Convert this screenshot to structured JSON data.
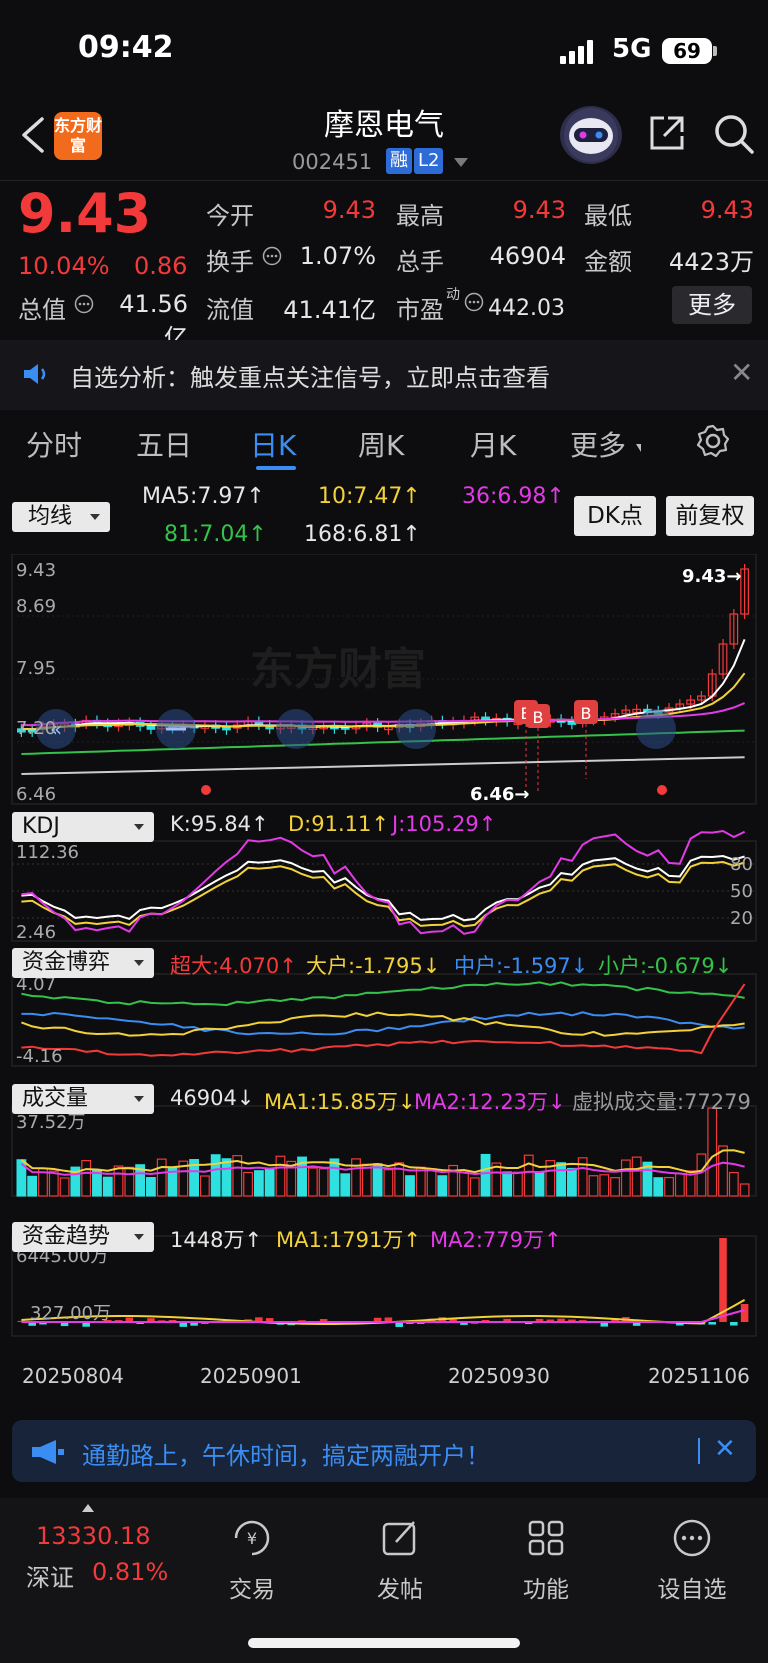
{
  "status": {
    "time": "09:42",
    "network": "5G",
    "battery": "69"
  },
  "header": {
    "logo_text": "东方财富",
    "name": "摩恩电气",
    "code": "002451",
    "tag_rong": "融",
    "tag_l2": "L2"
  },
  "quote": {
    "price": "9.43",
    "pct": "10.04%",
    "change": "0.86",
    "labels": {
      "open": "今开",
      "high": "最高",
      "low": "最低",
      "turnover": "换手",
      "volume": "总手",
      "amount": "金额",
      "total_cap": "总值",
      "float_cap": "流值",
      "pe": "市盈",
      "pe_sup": "动"
    },
    "values": {
      "open": "9.43",
      "high": "9.43",
      "low": "9.43",
      "turnover": "1.07%",
      "volume": "46904",
      "amount": "4423万",
      "total_cap": "41.56亿",
      "float_cap": "41.41亿",
      "pe": "442.03"
    },
    "more_label": "更多"
  },
  "notice": {
    "text": "自选分析：触发重点关注信号，立即点击查看"
  },
  "tabs": [
    "分时",
    "五日",
    "日K",
    "周K",
    "月K",
    "更多"
  ],
  "ma_bar": {
    "selector": "均线",
    "ma5": "MA5:7.97↑",
    "ma10": "10:7.47↑",
    "ma36": "36:6.98↑",
    "ma81": "81:7.04↑",
    "ma168": "168:6.81↑",
    "dk_button": "DK点",
    "adjust_button": "前复权"
  },
  "kline": {
    "y_labels": [
      "9.43",
      "8.69",
      "7.95",
      "7.20",
      "6.46"
    ],
    "high_tag": "9.43→",
    "low_tag": "6.46→",
    "watermark": "东方财富",
    "signals": [
      "B",
      "B",
      "B"
    ]
  },
  "kdj": {
    "selector": "KDJ",
    "k": "K:95.84↑",
    "d": "D:91.11↑",
    "j": "J:105.29↑",
    "y_top": "112.36",
    "y_bottom": "2.46",
    "levels": [
      "80",
      "50",
      "20"
    ]
  },
  "capital_game": {
    "selector": "资金博弈",
    "super": "超大:4.070↑",
    "big": "大户:-1.795↓",
    "mid": "中户:-1.597↓",
    "small": "小户:-0.679↓",
    "y_top": "4.07",
    "y_bottom": "-4.16"
  },
  "volume": {
    "selector": "成交量",
    "value": "46904↓",
    "ma1": "MA1:15.85万↓",
    "ma2": "MA2:12.23万↓",
    "virtual": "虚拟成交量:77279",
    "y_top": "37.52万"
  },
  "capital_trend": {
    "selector": "资金趋势",
    "value": "1448万↑",
    "ma1": "MA1:1791万↑",
    "ma2": "MA2:779万↑",
    "y_top": "6445.00万",
    "y_mid": "327.00万"
  },
  "dates": [
    "20250804",
    "20250901",
    "20250930",
    "20251106"
  ],
  "banner": {
    "text": "通勤路上，午休时间，搞定两融开户！"
  },
  "bottom_nav": {
    "index_value": "13330.18",
    "index_name": "深证",
    "index_pct": "0.81%",
    "items": [
      "交易",
      "发帖",
      "功能",
      "设自选"
    ]
  },
  "colors": {
    "up": "#f23a3a",
    "down": "#2ee0e0",
    "accent": "#3a8df2",
    "ma5": "#ffffff",
    "ma10": "#f2d23a",
    "ma36": "#e23ae6",
    "ma81": "#35c24a"
  }
}
